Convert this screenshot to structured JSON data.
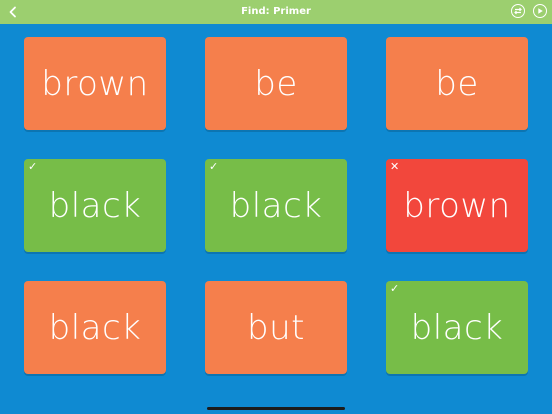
{
  "header": {
    "title": "Find: Primer",
    "back_icon": "chevron-left-icon",
    "icons": [
      "swap-icon",
      "play-icon"
    ]
  },
  "colors": {
    "background": "#0f8ad2",
    "header": "#9ccf6f",
    "card_default": "#f57f4c",
    "card_correct": "#77bd48",
    "card_wrong": "#f2473c"
  },
  "cards": [
    {
      "word": "brown",
      "state": "default"
    },
    {
      "word": "be",
      "state": "default"
    },
    {
      "word": "be",
      "state": "default"
    },
    {
      "word": "black",
      "state": "correct",
      "mark": "✓"
    },
    {
      "word": "black",
      "state": "correct",
      "mark": "✓"
    },
    {
      "word": "brown",
      "state": "wrong",
      "mark": "✕"
    },
    {
      "word": "black",
      "state": "default"
    },
    {
      "word": "but",
      "state": "default"
    },
    {
      "word": "black",
      "state": "correct",
      "mark": "✓"
    }
  ]
}
